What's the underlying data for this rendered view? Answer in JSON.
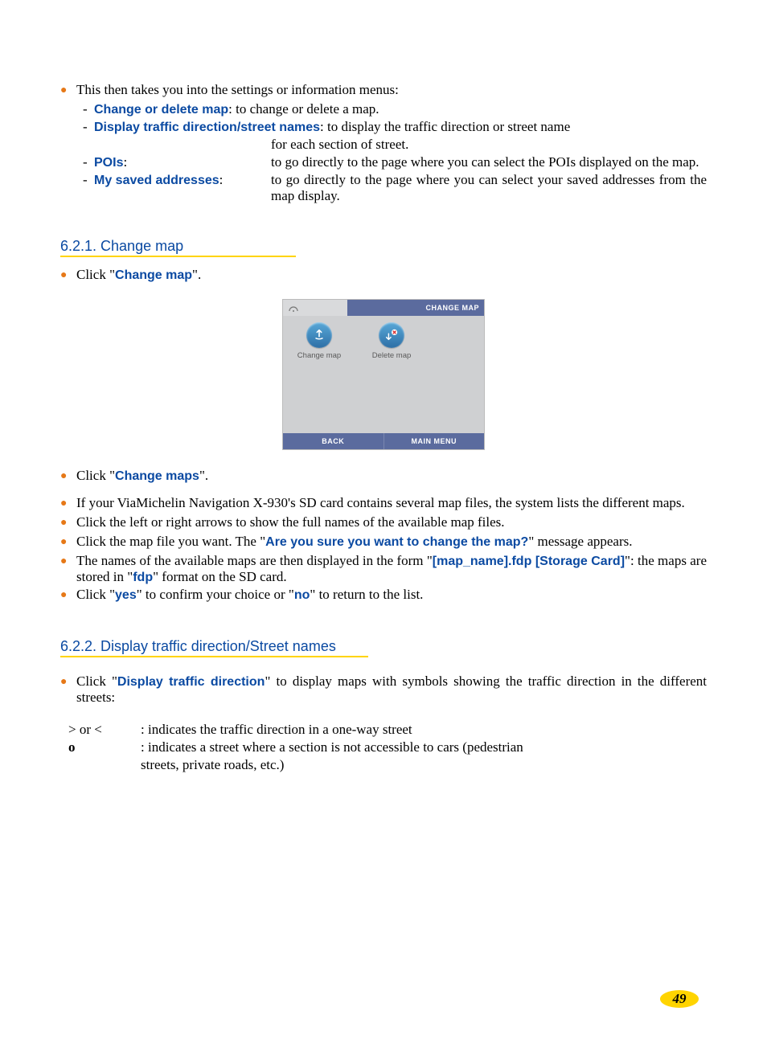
{
  "intro": "This then takes you into the settings or information menus:",
  "menu_items": [
    {
      "term": "Change or delete map",
      "sep": ":   ",
      "desc": "to change or delete a map."
    },
    {
      "term": "Display traffic direction/street names",
      "sep": ": ",
      "desc": "to display the traffic direction or street name for each section of street."
    },
    {
      "term": "POIs",
      "sep": ":",
      "desc": "to go directly to the page where you can select the POIs displayed on the map."
    },
    {
      "term": "My saved addresses",
      "sep": ":",
      "desc": "to go directly to the page where you can select your saved addresses from the map display."
    }
  ],
  "h621": "6.2.1. Change map",
  "s621": {
    "b1_pre": "Click \"",
    "b1_term": "Change map",
    "b1_post": "\".",
    "b2_pre": "Click \"",
    "b2_term": "Change maps",
    "b2_post": "\".",
    "b3": "If your ViaMichelin Navigation X-930's SD card contains several map files, the system lists the different maps.",
    "b4": "Click the left or right arrows to show the full names of the available map files.",
    "b5_pre": "Click the map file you want. The \"",
    "b5_term": "Are you sure you want to change the map?",
    "b5_post": "\" message appears.",
    "b6_pre": "The names of the available maps are then displayed in the form \"",
    "b6_term1": "[map_name].fdp [Storage Card]",
    "b6_mid": "\": the maps are stored in \"",
    "b6_term2": "fdp",
    "b6_post": "\" format on the SD card.",
    "b7_pre": "Click \"",
    "b7_term1": "yes",
    "b7_mid": "\" to confirm your choice or \"",
    "b7_term2": "no",
    "b7_post": "\" to return to the list."
  },
  "screenshot": {
    "title": "CHANGE MAP",
    "btn1": "Change map",
    "btn2": "Delete map",
    "back": "BACK",
    "main": "MAIN MENU"
  },
  "h622": "6.2.2. Display traffic direction/Street names",
  "s622": {
    "b1_pre": "Click \"",
    "b1_term": "Display traffic direction",
    "b1_post": "\" to display maps with symbols showing the traffic direction in the different streets:",
    "sym1": "> or <",
    "sym1_desc": ": indicates the traffic direction in a one-way street",
    "sym2": "o",
    "sym2_desc": ": indicates a street where a section is not accessible to cars (pedestrian",
    "sym2_desc2": "  streets, private roads, etc.)"
  },
  "page_number": "49"
}
